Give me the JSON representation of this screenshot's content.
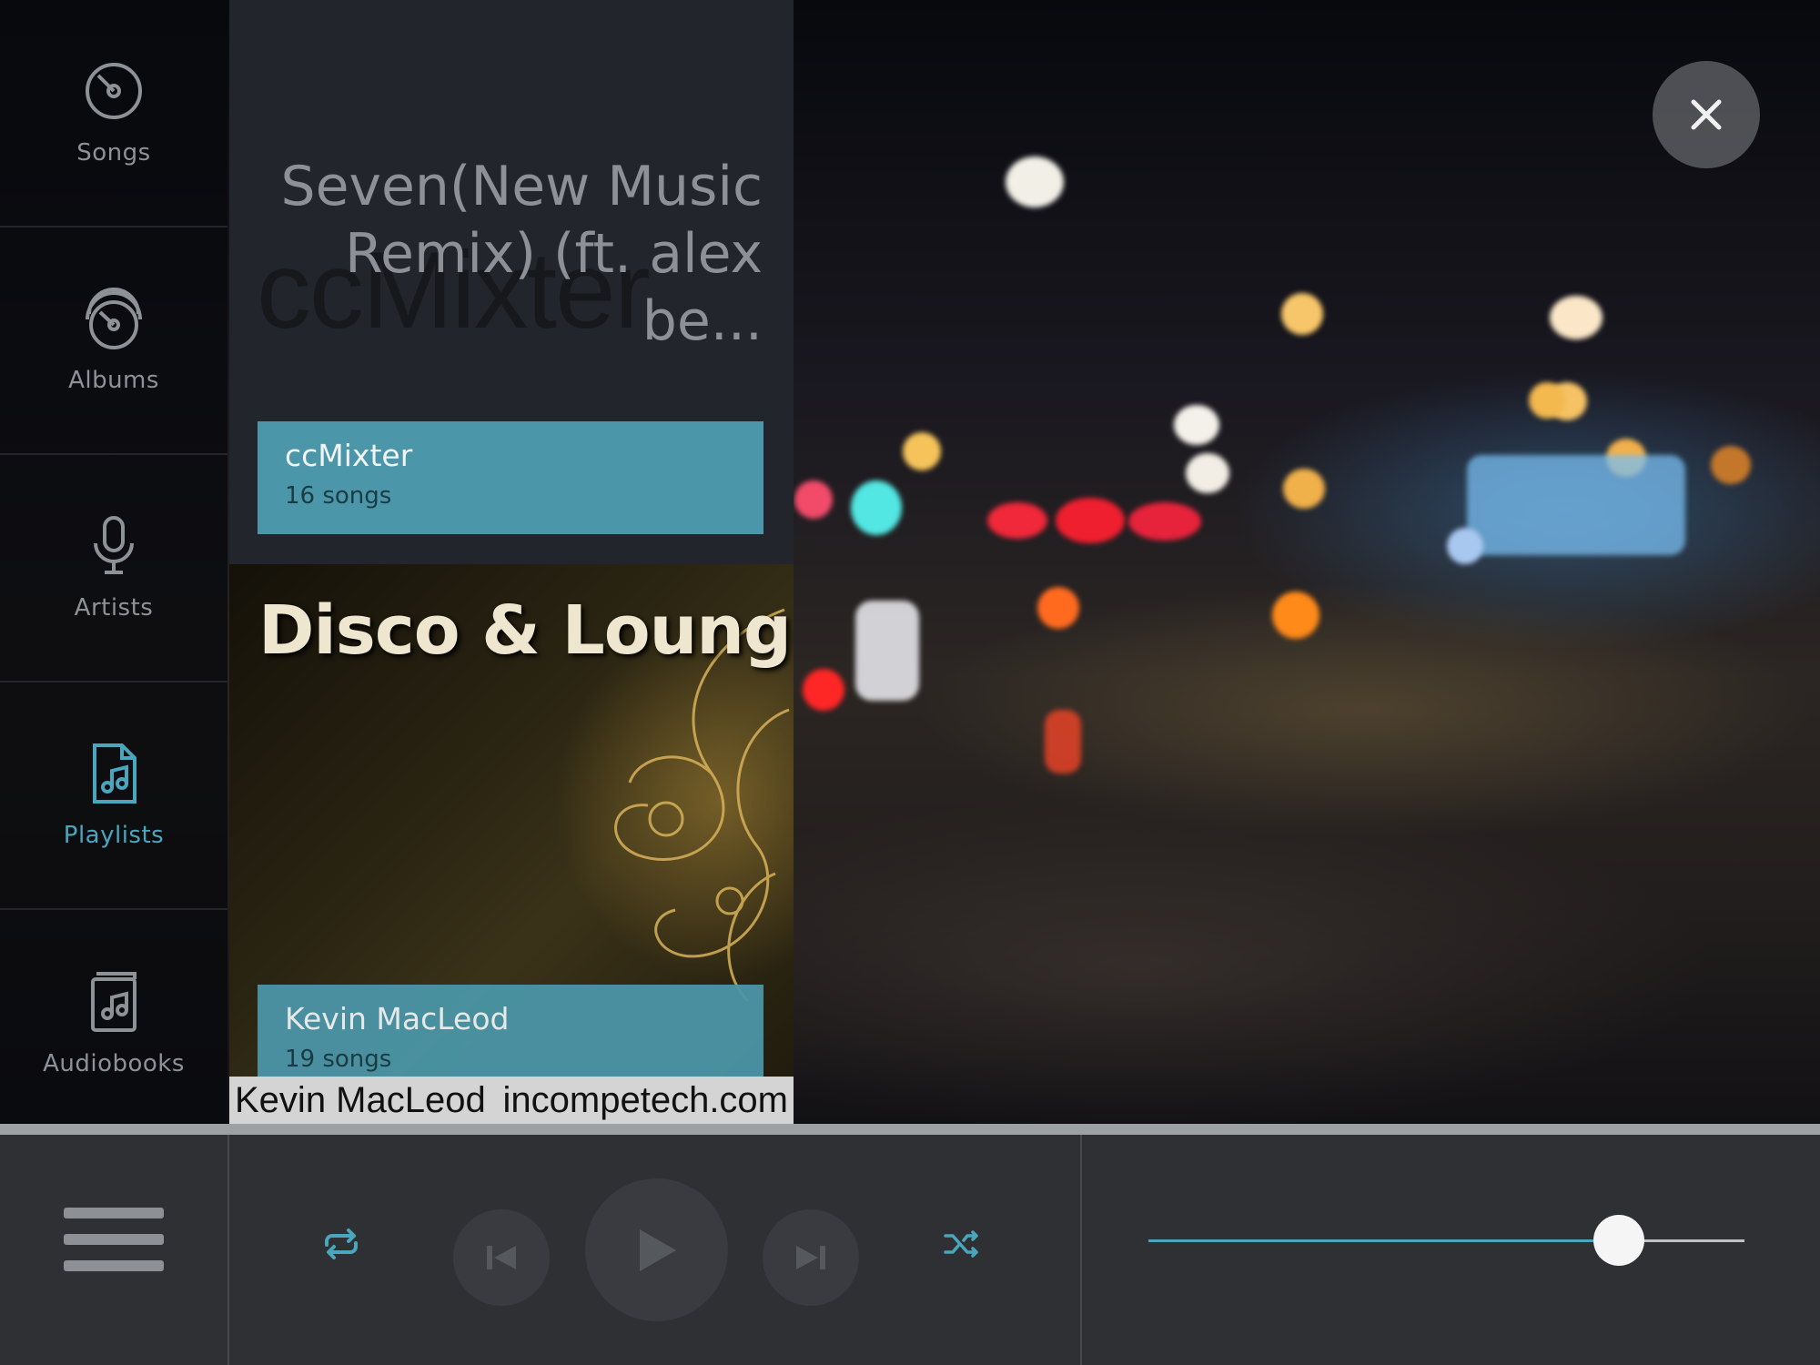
{
  "nav": {
    "items": [
      {
        "label": "Songs",
        "icon": "disc-icon"
      },
      {
        "label": "Albums",
        "icon": "discs-stack-icon"
      },
      {
        "label": "Artists",
        "icon": "microphone-icon"
      },
      {
        "label": "Playlists",
        "icon": "playlist-file-icon",
        "active": true
      },
      {
        "label": "Audiobooks",
        "icon": "audiobook-icon"
      }
    ]
  },
  "now_playing": {
    "title": "Seven(New Music Remix) (ft. alex be...",
    "ghost_text": "ccMixter"
  },
  "cards": [
    {
      "name": "ccMixter",
      "count": "16 songs"
    },
    {
      "name": "Kevin MacLeod",
      "count": "19 songs"
    }
  ],
  "album_art": {
    "title": "Disco & Lounge",
    "footer_left": "Kevin MacLeod",
    "footer_right": "incompetech.com"
  },
  "player": {
    "progress": 0.79
  },
  "colors": {
    "accent": "#4aa6bd",
    "card": "#4b96a8"
  }
}
